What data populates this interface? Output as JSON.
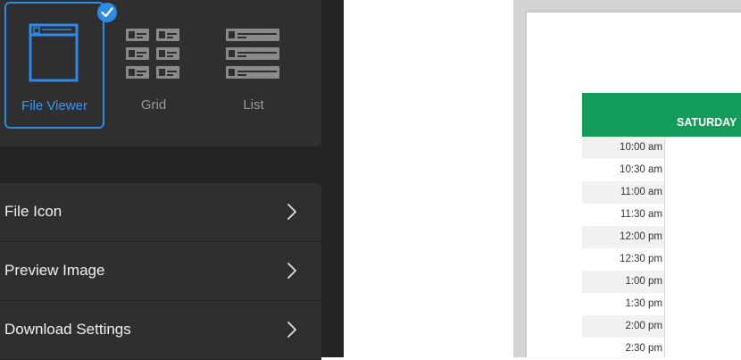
{
  "view_modes": {
    "options": [
      {
        "label": "File Viewer",
        "selected": true
      },
      {
        "label": "Grid",
        "selected": false
      },
      {
        "label": "List",
        "selected": false
      }
    ]
  },
  "settings": {
    "items": [
      {
        "label": "File Icon"
      },
      {
        "label": "Preview Image"
      },
      {
        "label": "Download Settings"
      }
    ]
  },
  "schedule": {
    "day_header": "SATURDAY",
    "times": [
      "10:00 am",
      "10:30 am",
      "11:00 am",
      "11:30 am",
      "12:00 pm",
      "12:30 pm",
      "1:00 pm",
      "1:30 pm",
      "2:00 pm",
      "2:30 pm"
    ]
  },
  "colors": {
    "accent": "#2d8ae8",
    "panel_bg": "#232323",
    "card_bg": "#2f2f2f",
    "header_green": "#139c5c"
  }
}
